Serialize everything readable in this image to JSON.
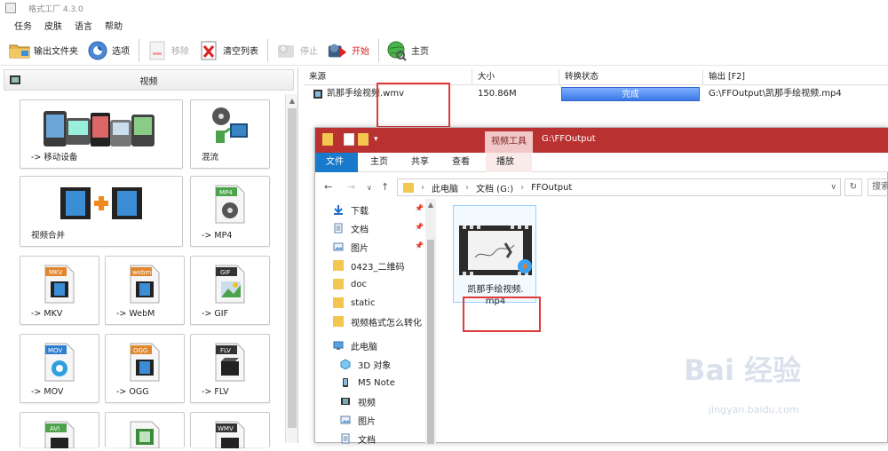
{
  "app": {
    "title": "格式工厂 4.3.0"
  },
  "menu": [
    "任务",
    "皮肤",
    "语言",
    "帮助"
  ],
  "toolbar": {
    "output_folder": "输出文件夹",
    "options": "选项",
    "remove": "移除",
    "clear_list": "清空列表",
    "stop": "停止",
    "start": "开始",
    "home": "主页"
  },
  "left_panel": {
    "header": "视频",
    "tiles": [
      {
        "label": "-> 移动设备",
        "icon": "mobile-devices-icon"
      },
      {
        "label": "混流",
        "icon": "mux-icon"
      },
      {
        "label": "视频合并",
        "icon": "video-join-icon"
      },
      {
        "label": "-> MP4",
        "icon": "mp4-icon",
        "badge": "MP4"
      },
      {
        "label": "-> MKV",
        "icon": "mkv-icon",
        "badge": "MKV"
      },
      {
        "label": "-> WebM",
        "icon": "webm-icon",
        "badge": "webm"
      },
      {
        "label": "-> GIF",
        "icon": "gif-icon",
        "badge": "GIF"
      },
      {
        "label": "-> MOV",
        "icon": "mov-icon",
        "badge": "MOV"
      },
      {
        "label": "-> OGG",
        "icon": "ogg-icon",
        "badge": "OGG"
      },
      {
        "label": "-> FLV",
        "icon": "flv-icon",
        "badge": "FLV"
      },
      {
        "label": "",
        "icon": "avi-icon",
        "badge": "AVI"
      },
      {
        "label": "",
        "icon": "3gp-icon",
        "badge": ""
      },
      {
        "label": "",
        "icon": "wmv-icon",
        "badge": "WMV"
      }
    ]
  },
  "task_table": {
    "headers": [
      "来源",
      "大小",
      "转换状态",
      "输出 [F2]"
    ],
    "rows": [
      {
        "source": "凯那手绘视频.wmv",
        "size": "150.86M",
        "status": "完成",
        "status_progress": 1.0,
        "output": "G:\\FFOutput\\凯那手绘视频.mp4"
      }
    ]
  },
  "explorer": {
    "context_tab": "视频工具",
    "path_title": "G:\\FFOutput",
    "ribbon_tabs": [
      "文件",
      "主页",
      "共享",
      "查看",
      "播放"
    ],
    "breadcrumb": [
      "此电脑",
      "文档 (G:)",
      "FFOutput"
    ],
    "search_placeholder": "搜索",
    "nav_items": [
      {
        "label": "下载",
        "icon": "download-icon",
        "pinned": true
      },
      {
        "label": "文档",
        "icon": "documents-icon",
        "pinned": true
      },
      {
        "label": "图片",
        "icon": "pictures-icon",
        "pinned": true
      },
      {
        "label": "0423_二维码",
        "icon": "folder-icon",
        "pinned": false
      },
      {
        "label": "doc",
        "icon": "folder-icon",
        "pinned": false
      },
      {
        "label": "static",
        "icon": "folder-icon",
        "pinned": false
      },
      {
        "label": "视频格式怎么转化",
        "icon": "folder-icon",
        "pinned": false
      },
      {
        "label": "此电脑",
        "icon": "this-pc-icon",
        "pinned": false
      },
      {
        "label": "3D 对象",
        "icon": "3d-objects-icon",
        "pinned": false
      },
      {
        "label": "M5 Note",
        "icon": "phone-icon",
        "pinned": false
      },
      {
        "label": "视频",
        "icon": "videos-icon",
        "pinned": false
      },
      {
        "label": "图片",
        "icon": "pictures-icon",
        "pinned": false
      },
      {
        "label": "文档",
        "icon": "documents-icon",
        "pinned": false
      }
    ],
    "file": {
      "name_line1": "凯那手绘视频.",
      "name_line2": "mp4"
    }
  },
  "watermark": {
    "brand": "Bai 经验",
    "url": "jingyan.baidu.com"
  },
  "colors": {
    "explorer_title": "#b93131",
    "ribbon_active": "#1979ca",
    "progress": "#3b78e7",
    "highlight_box": "#e23a3a"
  }
}
